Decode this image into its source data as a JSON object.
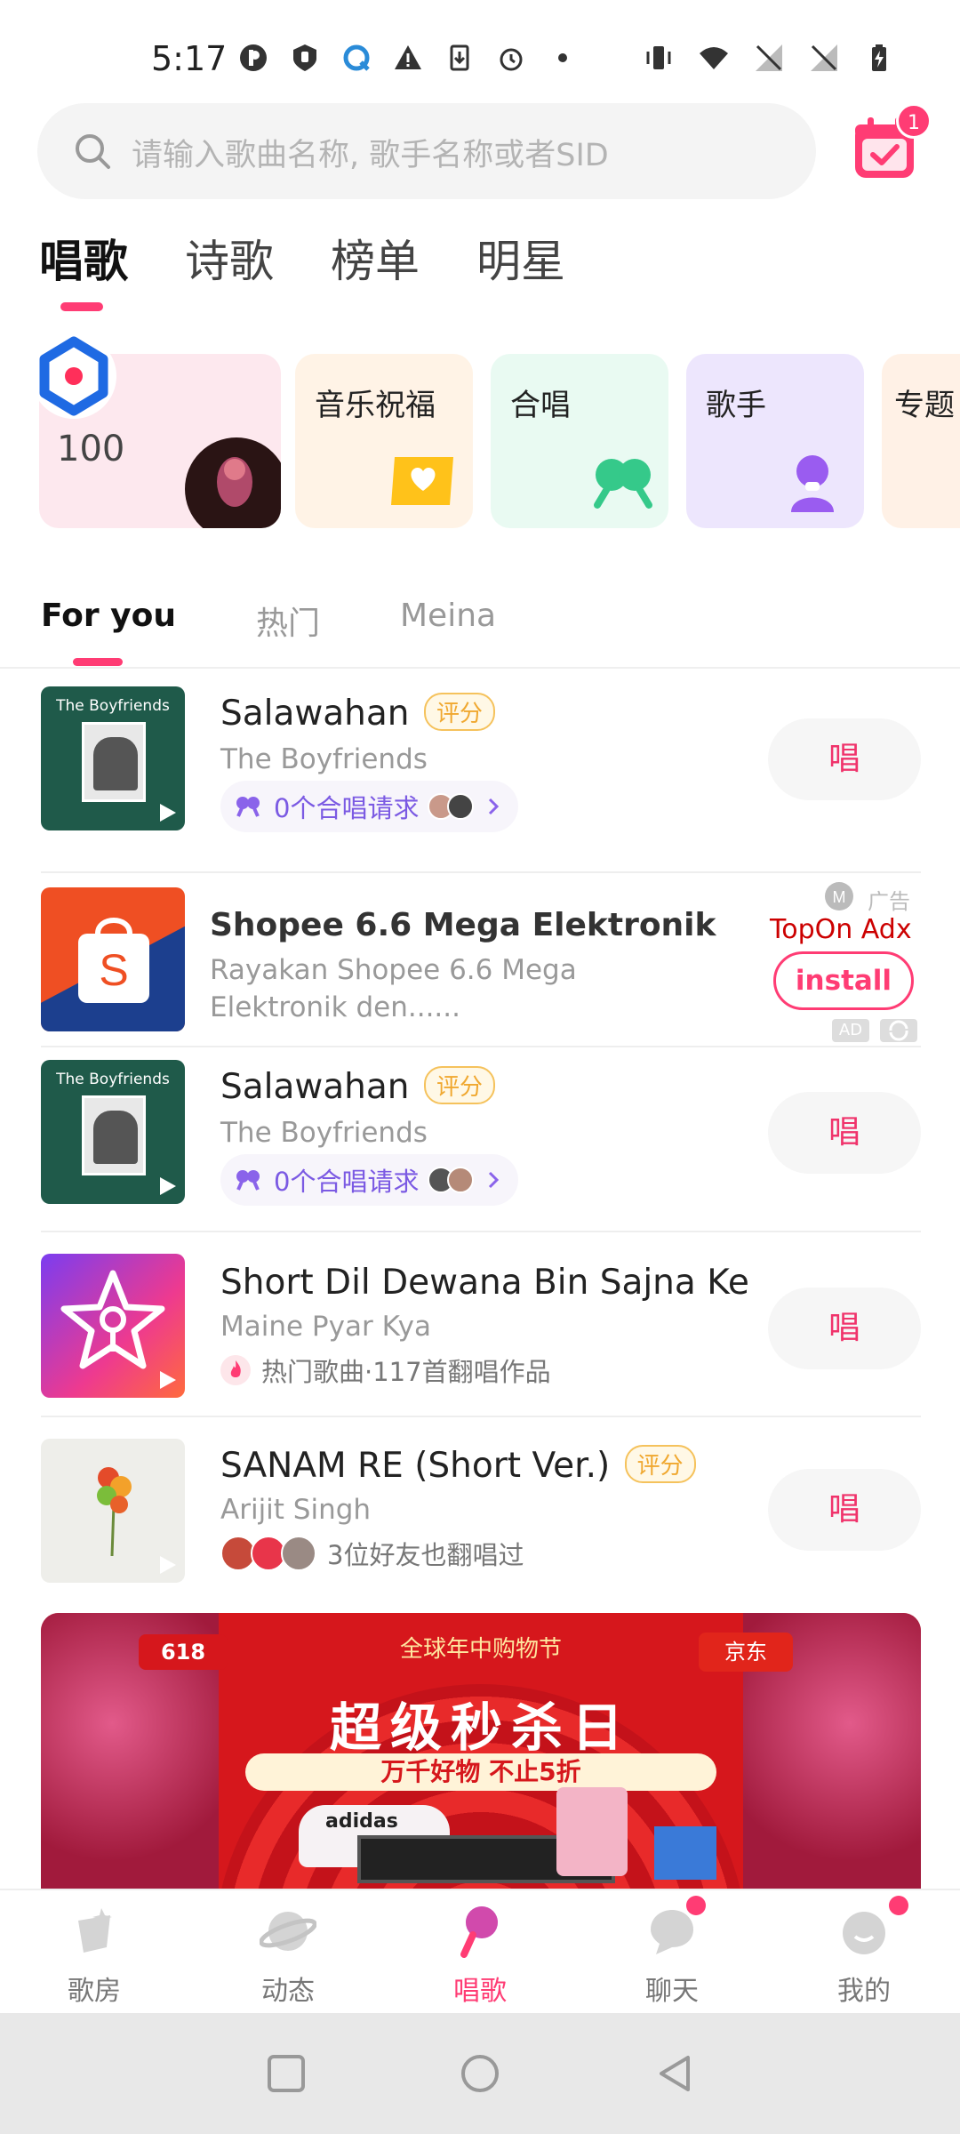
{
  "status_bar": {
    "time": "5:17"
  },
  "search": {
    "placeholder": "请输入歌曲名称, 歌手名称或者SID",
    "calendar_badge": "1"
  },
  "main_tabs": [
    {
      "label": "唱歌",
      "active": true
    },
    {
      "label": "诗歌",
      "active": false
    },
    {
      "label": "榜单",
      "active": false
    },
    {
      "label": "明星",
      "active": false
    }
  ],
  "categories": [
    {
      "label": "",
      "sub": "100"
    },
    {
      "label": "音乐祝福"
    },
    {
      "label": "合唱"
    },
    {
      "label": "歌手"
    },
    {
      "label": "专题"
    }
  ],
  "sub_tabs": [
    {
      "label": "For you",
      "active": true
    },
    {
      "label": "热门",
      "active": false
    },
    {
      "label": "Meina",
      "active": false
    }
  ],
  "songs": [
    {
      "title": "Salawahan",
      "badge": "评分",
      "artist": "The Boyfriends",
      "extra": "0个合唱请求",
      "action": "唱",
      "cover_text": "The Boyfriends"
    },
    {
      "title": "Salawahan",
      "badge": "评分",
      "artist": "The Boyfriends",
      "extra": "0个合唱请求",
      "action": "唱",
      "cover_text": "The Boyfriends"
    },
    {
      "title": "Short Dil Dewana Bin Sajna Ke",
      "artist": "Maine Pyar Kya",
      "extra": "热门歌曲·117首翻唱作品",
      "action": "唱"
    },
    {
      "title": "SANAM RE (Short Ver.)",
      "badge": "评分",
      "artist": "Arijit Singh",
      "extra": "3位好友也翻唱过",
      "action": "唱"
    }
  ],
  "ad": {
    "title": "Shopee 6.6 Mega Elektronik",
    "description": "Rayakan Shopee 6.6 Mega Elektronik den......",
    "ad_label": "广告",
    "source": "TopOn Adx",
    "install_label": "install",
    "ad_tag": "AD"
  },
  "banner": {
    "top_text": "全球年中购物节",
    "title": "超级秒杀日",
    "subtitle": "万千好物 不止5折",
    "left_tag": "618",
    "right_tag": "京东",
    "product_text": "adidas"
  },
  "bottom_nav": [
    {
      "label": "歌房",
      "active": false,
      "dot": false
    },
    {
      "label": "动态",
      "active": false,
      "dot": false
    },
    {
      "label": "唱歌",
      "active": true,
      "dot": false
    },
    {
      "label": "聊天",
      "active": false,
      "dot": true
    },
    {
      "label": "我的",
      "active": false,
      "dot": true
    }
  ],
  "colors": {
    "accent": "#ff3c74",
    "chorus": "#7b5ae3",
    "rate": "#f0a830"
  },
  "icons": [
    "search-icon",
    "calendar-icon",
    "play-icon",
    "chorus-icon",
    "fire-icon",
    "chevron-right-icon",
    "shopee-logo-icon"
  ]
}
